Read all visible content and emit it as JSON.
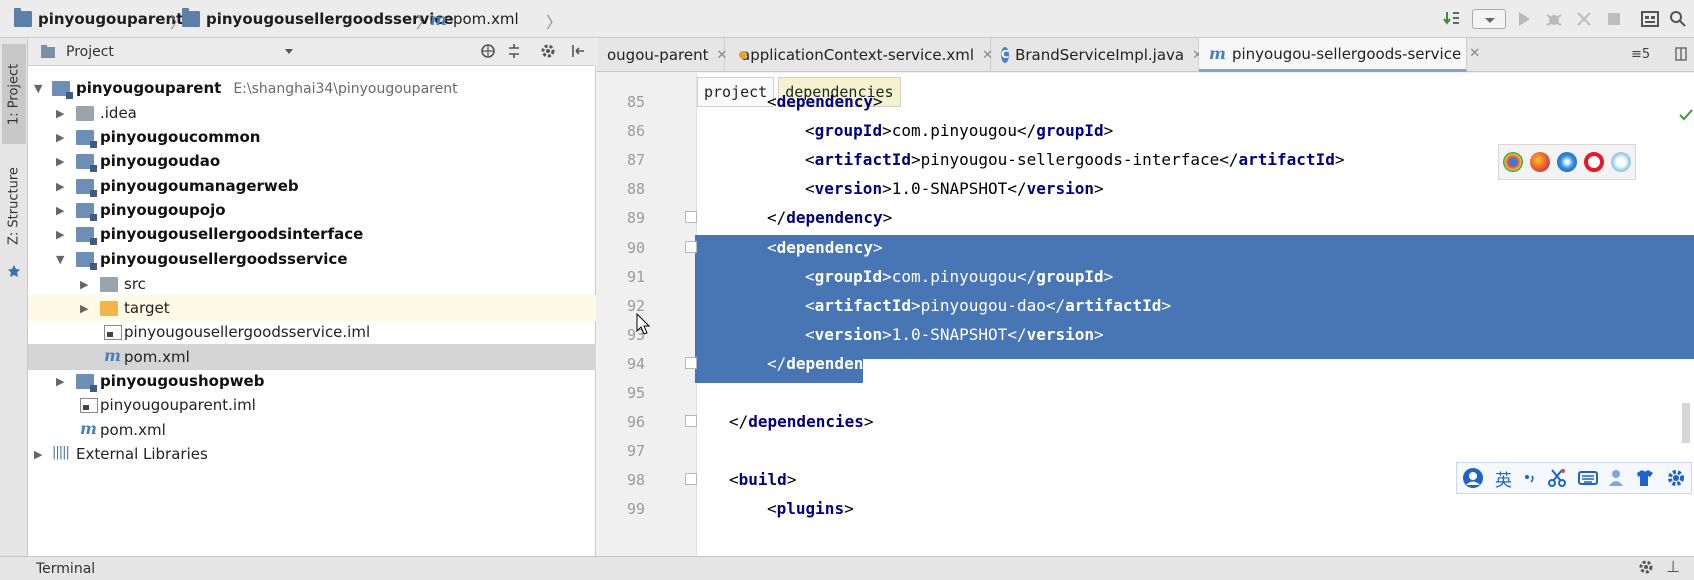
{
  "navbar": {
    "crumbs": [
      "pinyougouparent",
      "pinyougousellergoodsservice",
      "pom.xml"
    ]
  },
  "left_strip": {
    "tab_project": "1: Project",
    "tab_structure": "Z: Structure"
  },
  "project_panel": {
    "title": "Project",
    "tree": [
      {
        "label": "pinyougouparent",
        "path": "E:\\shanghai34\\pinyougouparent"
      },
      {
        "label": ".idea"
      },
      {
        "label": "pinyougoucommon"
      },
      {
        "label": "pinyougoudao"
      },
      {
        "label": "pinyougoumanagerweb"
      },
      {
        "label": "pinyougoupojo"
      },
      {
        "label": "pinyougousellergoodsinterface"
      },
      {
        "label": "pinyougousellergoodsservice"
      },
      {
        "label": "src"
      },
      {
        "label": "target"
      },
      {
        "label": "pinyougousellergoodsservice.iml"
      },
      {
        "label": "pom.xml"
      },
      {
        "label": "pinyougoushopweb"
      },
      {
        "label": "pinyougouparent.iml"
      },
      {
        "label": "pom.xml"
      },
      {
        "label": "External Libraries"
      }
    ]
  },
  "editor": {
    "tabs": [
      {
        "label": "ougou-parent"
      },
      {
        "label": "applicationContext-service.xml"
      },
      {
        "label": "BrandServiceImpl.java"
      },
      {
        "label": "pinyougou-sellergoods-service"
      }
    ],
    "tab_overflow": "≡5",
    "xml_breadcrumb": [
      "project",
      "dependencies"
    ],
    "lines": [
      {
        "num": "85",
        "indent": 2,
        "a": "<",
        "tag": "dependency",
        "b": ">"
      },
      {
        "num": "86",
        "indent": 3,
        "open": "groupId",
        "text": "com.pinyougou",
        "close": "groupId"
      },
      {
        "num": "87",
        "indent": 3,
        "open": "artifactId",
        "text": "pinyougou-sellergoods-interface",
        "close": "artifactId"
      },
      {
        "num": "88",
        "indent": 3,
        "open": "version",
        "text": "1.0-SNAPSHOT",
        "close": "version"
      },
      {
        "num": "89",
        "indent": 2,
        "a": "</",
        "tag": "dependency",
        "b": ">"
      },
      {
        "num": "90",
        "indent": 2,
        "a": "<",
        "tag": "dependency",
        "b": ">"
      },
      {
        "num": "91",
        "indent": 3,
        "open": "groupId",
        "text": "com.pinyougou",
        "close": "groupId"
      },
      {
        "num": "92",
        "indent": 3,
        "open": "artifactId",
        "text": "pinyougou-dao",
        "close": "artifactId"
      },
      {
        "num": "93",
        "indent": 3,
        "open": "version",
        "text": "1.0-SNAPSHOT",
        "close": "version"
      },
      {
        "num": "94",
        "indent": 2,
        "a": "</",
        "tag": "dependency",
        "b": ">"
      },
      {
        "num": "95",
        "indent": 0
      },
      {
        "num": "96",
        "indent": 1,
        "a": "</",
        "tag": "dependencies",
        "b": ">"
      },
      {
        "num": "97",
        "indent": 0
      },
      {
        "num": "98",
        "indent": 1,
        "a": "<",
        "tag": "build",
        "b": ">"
      },
      {
        "num": "99",
        "indent": 2,
        "a": "<",
        "tag": "plugins",
        "b": ">"
      }
    ],
    "selected_lines": [
      "90",
      "91",
      "92",
      "93",
      "94"
    ]
  },
  "ime_toolbar": {
    "lang": "英"
  },
  "bottom_bar": {
    "terminal": "Terminal"
  },
  "colors": {
    "selection": "#2a5ea7",
    "tag": "#000080",
    "folder_orange": "#f4b44b"
  }
}
